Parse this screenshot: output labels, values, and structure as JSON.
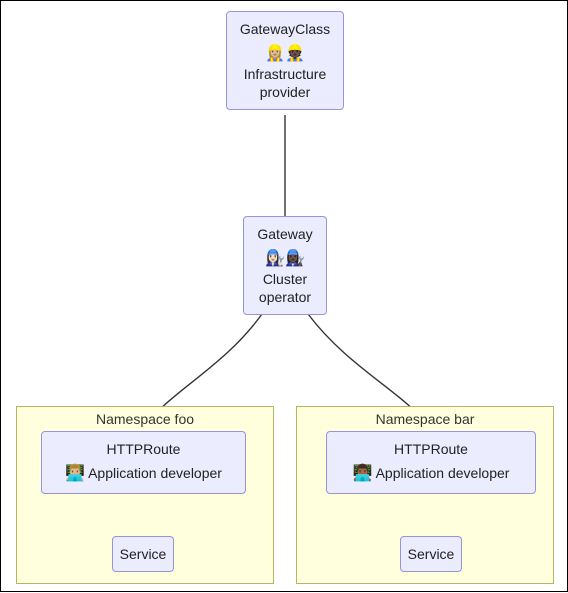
{
  "nodes": {
    "gateway_class": {
      "title": "GatewayClass",
      "emoji": "👷🏼‍♀️👷🏿",
      "role_line1": "Infrastructure",
      "role_line2": "provider"
    },
    "gateway": {
      "title": "Gateway",
      "emoji": "👩🏻‍🔧👩🏿‍🔧",
      "role_line1": "Cluster",
      "role_line2": "operator"
    },
    "httproute_foo": {
      "title": "HTTPRoute",
      "emoji": "👨🏼‍💻",
      "role": "Application developer"
    },
    "httproute_bar": {
      "title": "HTTPRoute",
      "emoji": "👨🏾‍💻",
      "role": "Application developer"
    },
    "service_foo": {
      "label": "Service"
    },
    "service_bar": {
      "label": "Service"
    }
  },
  "clusters": {
    "foo": {
      "label": "Namespace foo"
    },
    "bar": {
      "label": "Namespace bar"
    }
  }
}
